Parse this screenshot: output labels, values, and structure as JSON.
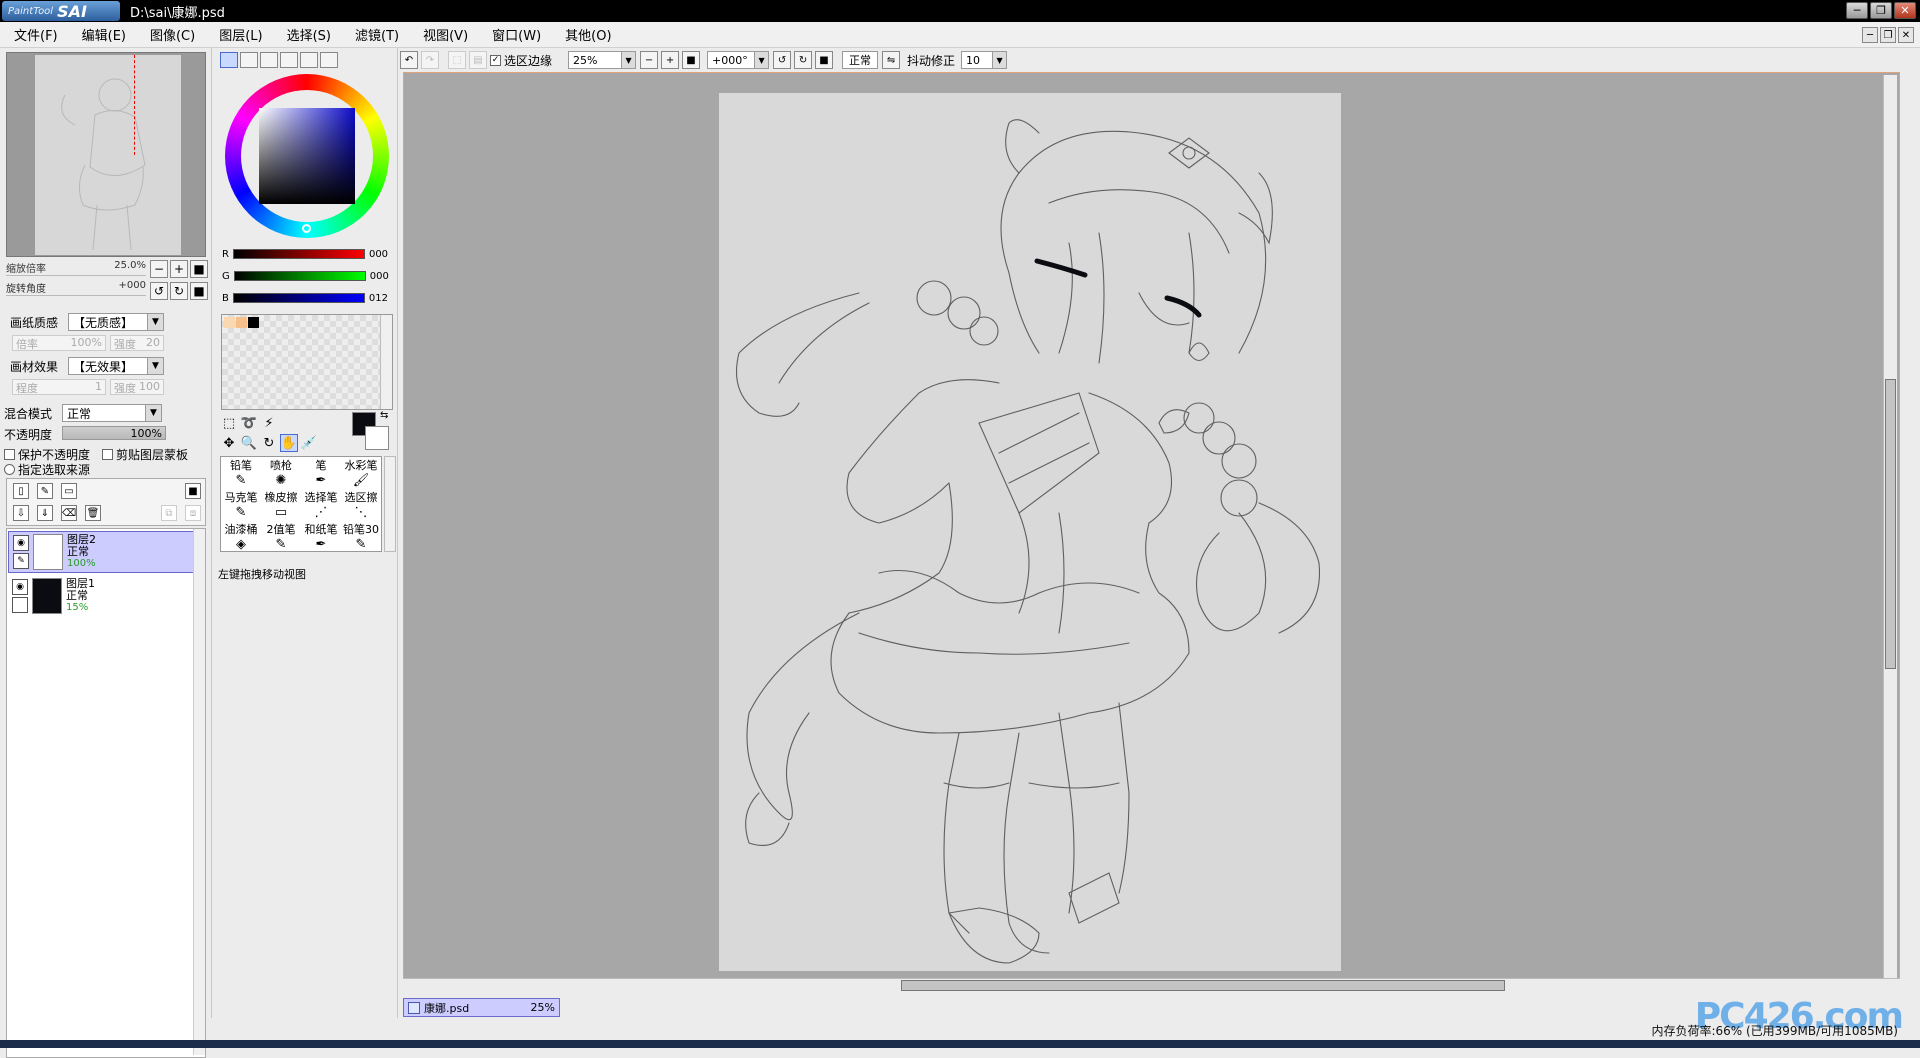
{
  "app": {
    "logo_small": "PaintTool",
    "logo_big": "SAI",
    "window_title": "D:\\sai\\康娜.psd"
  },
  "menu": [
    "文件(F)",
    "编辑(E)",
    "图像(C)",
    "图层(L)",
    "选择(S)",
    "滤镜(T)",
    "视图(V)",
    "窗口(W)",
    "其他(O)"
  ],
  "navigator": {
    "zoom_label": "缩放倍率",
    "zoom_value": "25.0%",
    "rotate_label": "旋转角度",
    "rotate_value": "+000"
  },
  "texture": {
    "paper_label": "画纸质感",
    "paper_value": "【无质感】",
    "paper_scale_label": "倍率",
    "paper_scale_value": "100%",
    "paper_strength_label": "强度",
    "paper_strength_value": "20",
    "effect_label": "画材效果",
    "effect_value": "【无效果】",
    "effect_degree_label": "程度",
    "effect_degree_value": "1",
    "effect_strength_label": "强度",
    "effect_strength_value": "100"
  },
  "layer_props": {
    "blend_label": "混合模式",
    "blend_value": "正常",
    "opacity_label": "不透明度",
    "opacity_value": "100%",
    "protect_opacity": "保护不透明度",
    "clipping": "剪贴图层蒙板",
    "selection_source": "指定选取来源"
  },
  "layers": [
    {
      "name": "图层2",
      "mode": "正常",
      "opacity": "100%",
      "selected": true
    },
    {
      "name": "图层1",
      "mode": "正常",
      "opacity": "15%",
      "selected": false
    }
  ],
  "color": {
    "r_label": "R",
    "r_value": "000",
    "g_label": "G",
    "g_value": "000",
    "b_label": "B",
    "b_value": "012",
    "foreground": "#0b0b12",
    "background": "#ffffff"
  },
  "brushes": [
    {
      "label": "铅笔",
      "icon": "✎"
    },
    {
      "label": "喷枪",
      "icon": "✺"
    },
    {
      "label": "笔",
      "icon": "✒"
    },
    {
      "label": "水彩笔",
      "icon": "🖌"
    },
    {
      "label": "马克笔",
      "icon": "✎"
    },
    {
      "label": "橡皮擦",
      "icon": "▭"
    },
    {
      "label": "选择笔",
      "icon": "⋰"
    },
    {
      "label": "选区擦",
      "icon": "⋱"
    },
    {
      "label": "油漆桶",
      "icon": "◈"
    },
    {
      "label": "2值笔",
      "icon": "✎"
    },
    {
      "label": "和纸笔",
      "icon": "✒"
    },
    {
      "label": "铅笔30",
      "icon": "✎"
    }
  ],
  "hint": "左键拖拽移动视图",
  "canvas_toolbar": {
    "selection_edge": "选区边缘",
    "zoom": "25%",
    "angle": "+000°",
    "mode": "正常",
    "stabilizer_label": "抖动修正",
    "stabilizer_value": "10"
  },
  "document_tab": {
    "name": "康娜.psd",
    "zoom": "25%"
  },
  "status": "内存负荷率:66% (已用399MB/可用1085MB)",
  "watermark": "PC426.com"
}
